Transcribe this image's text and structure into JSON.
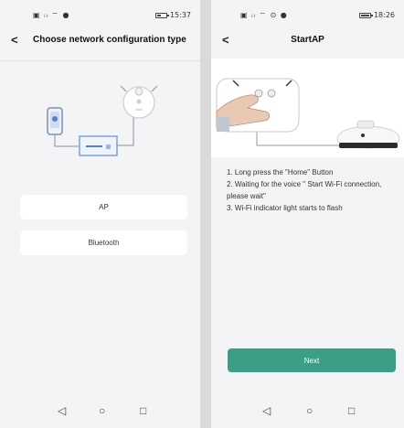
{
  "left": {
    "status": {
      "time": "15:37"
    },
    "header": {
      "back_glyph": "<",
      "title": "Choose network configuration type"
    },
    "options": [
      {
        "label": "AP"
      },
      {
        "label": "Bluetooth"
      }
    ]
  },
  "right": {
    "status": {
      "time": "18:26"
    },
    "header": {
      "back_glyph": "<",
      "title": "StartAP"
    },
    "instructions": [
      "1. Long press the \"Home\" Button",
      "2. Waiting for the voice \" Start Wi-Fi connection, please wait\"",
      "3. Wi-Fi indicator light starts to flash"
    ],
    "next_label": "Next"
  },
  "navbar": {
    "back": "◁",
    "home": "○",
    "recent": "□"
  },
  "colors": {
    "accent": "#3d9e88",
    "background": "#f4f4f6",
    "card": "#ffffff"
  },
  "icons": [
    "signal-icon",
    "wifi-icon",
    "battery-icon",
    "phone-icon",
    "router-icon",
    "robot-vacuum-icon",
    "hand-icon"
  ]
}
